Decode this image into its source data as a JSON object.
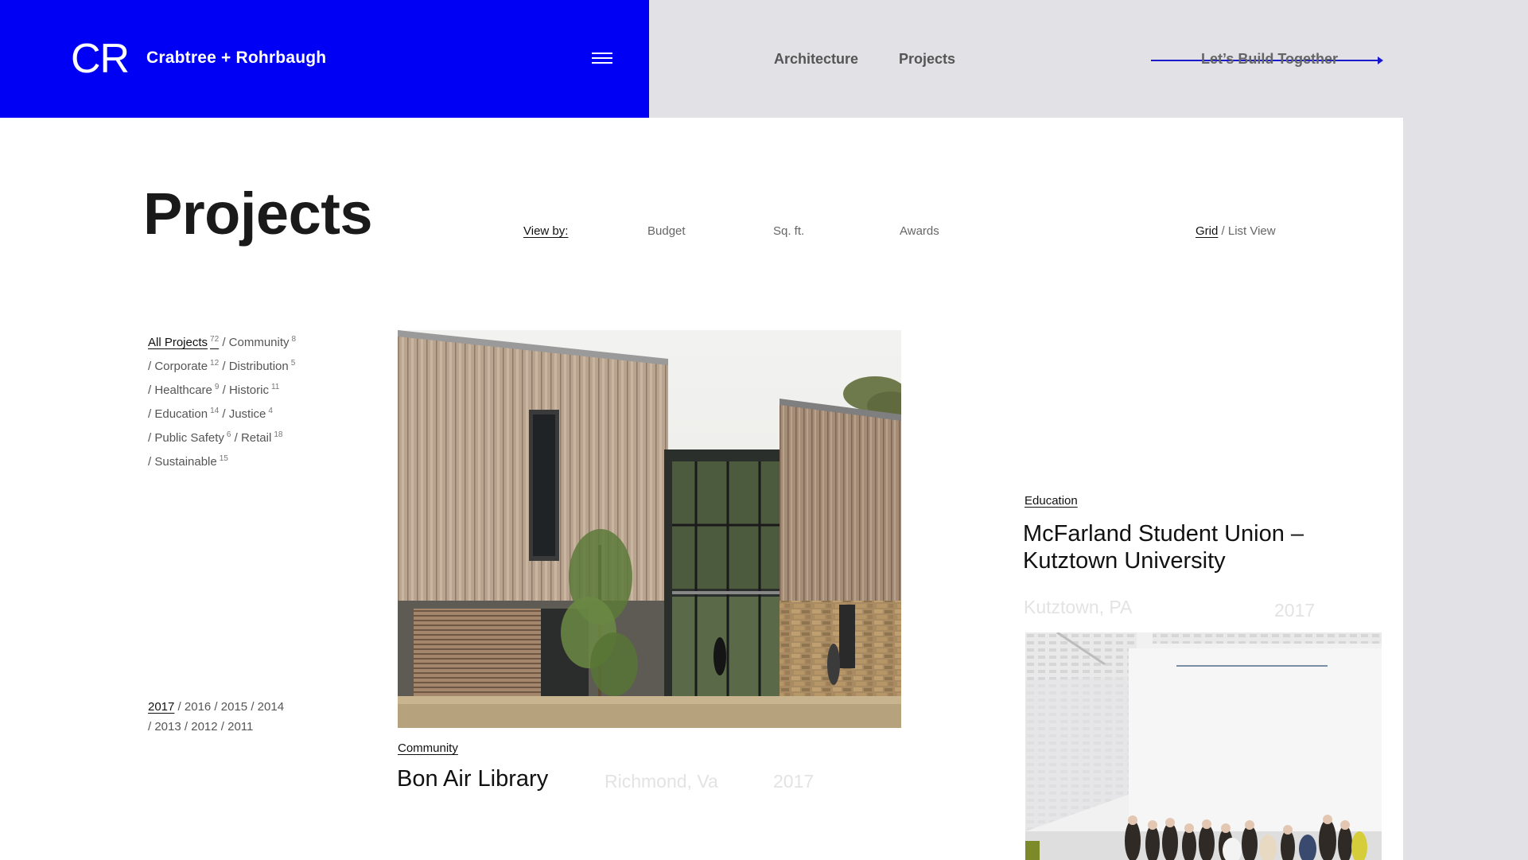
{
  "header": {
    "logo_mark": "CR",
    "firm_name": "Crabtree + Rohrbaugh",
    "nav": [
      "Architecture",
      "Projects"
    ],
    "cta": "Let’s Build Together"
  },
  "page": {
    "title": "Projects",
    "view_by_label": "View by:",
    "sort_options": [
      "Budget",
      "Sq. ft.",
      "Awards"
    ],
    "view_grid": "Grid",
    "view_list": "List View",
    "view_separator": " / "
  },
  "filters": [
    {
      "label": "All Projects",
      "count": "72",
      "active": true
    },
    {
      "label": "Community",
      "count": "8"
    },
    {
      "label": "Corporate",
      "count": "12"
    },
    {
      "label": "Distribution",
      "count": "5"
    },
    {
      "label": "Healthcare",
      "count": "9"
    },
    {
      "label": "Historic",
      "count": "11"
    },
    {
      "label": "Education",
      "count": "14"
    },
    {
      "label": "Justice",
      "count": "4"
    },
    {
      "label": "Public Safety",
      "count": "6"
    },
    {
      "label": "Retail",
      "count": "18"
    },
    {
      "label": "Sustainable",
      "count": "15"
    }
  ],
  "years": [
    "2017",
    "2016",
    "2015",
    "2014",
    "2013",
    "2012",
    "2011"
  ],
  "projects": [
    {
      "category": "Community",
      "title": "Bon Air Library",
      "location": "Richmond, Va",
      "year": "2017"
    },
    {
      "category": "Education",
      "title": "McFarland Student Union – Kutztown University",
      "location": "Kutztown, PA",
      "year": "2017"
    }
  ],
  "colors": {
    "brand_blue": "#0000f5",
    "background_gray": "#e1e1e6"
  }
}
